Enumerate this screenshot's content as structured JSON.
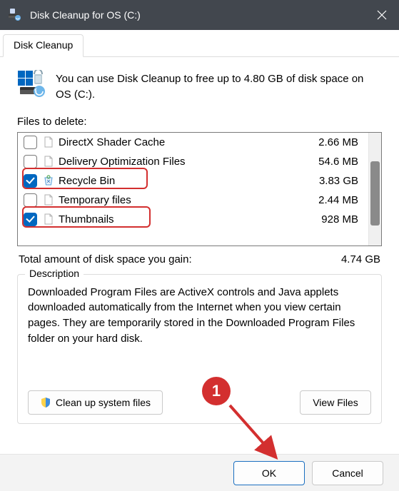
{
  "titlebar": {
    "title": "Disk Cleanup for OS (C:)"
  },
  "tab": {
    "label": "Disk Cleanup"
  },
  "intro": "You can use Disk Cleanup to free up to 4.80 GB of disk space on OS (C:).",
  "files_label": "Files to delete:",
  "files": [
    {
      "name": "DirectX Shader Cache",
      "size": "2.66 MB",
      "checked": false,
      "icon": "file"
    },
    {
      "name": "Delivery Optimization Files",
      "size": "54.6 MB",
      "checked": false,
      "icon": "file"
    },
    {
      "name": "Recycle Bin",
      "size": "3.83 GB",
      "checked": true,
      "icon": "recycle"
    },
    {
      "name": "Temporary files",
      "size": "2.44 MB",
      "checked": false,
      "icon": "file"
    },
    {
      "name": "Thumbnails",
      "size": "928 MB",
      "checked": true,
      "icon": "file"
    }
  ],
  "total": {
    "label": "Total amount of disk space you gain:",
    "value": "4.74 GB"
  },
  "description": {
    "legend": "Description",
    "text": "Downloaded Program Files are ActiveX controls and Java applets downloaded automatically from the Internet when you view certain pages. They are temporarily stored in the Downloaded Program Files folder on your hard disk."
  },
  "buttons": {
    "cleanup": "Clean up system files",
    "viewfiles": "View Files",
    "ok": "OK",
    "cancel": "Cancel"
  },
  "annotation": {
    "badge": "1"
  }
}
